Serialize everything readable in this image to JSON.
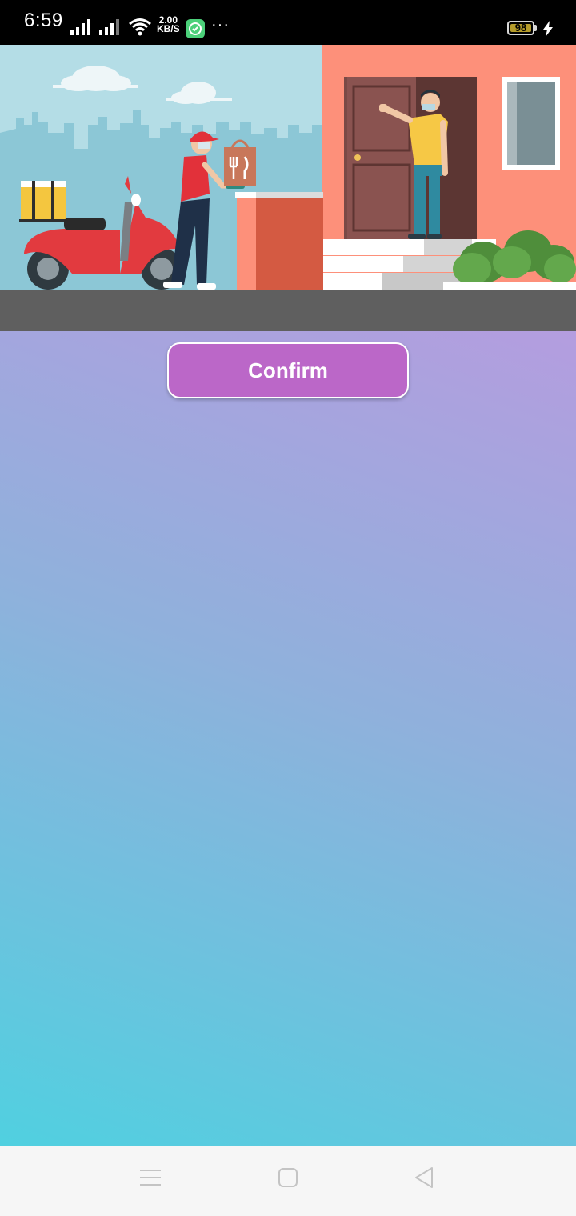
{
  "status_bar": {
    "time": "6:59",
    "net_speed_value": "2.00",
    "net_speed_unit": "KB/S",
    "more": "···",
    "battery_level": "98"
  },
  "hero": {
    "icon": "delivery-illustration"
  },
  "main": {
    "confirm_label": "Confirm",
    "background_colors": [
      "#b49ddf",
      "#8fb1dc",
      "#50d0e0"
    ]
  },
  "nav_bar": {
    "icons": [
      "menu-icon",
      "home-square-icon",
      "back-triangle-icon"
    ]
  }
}
